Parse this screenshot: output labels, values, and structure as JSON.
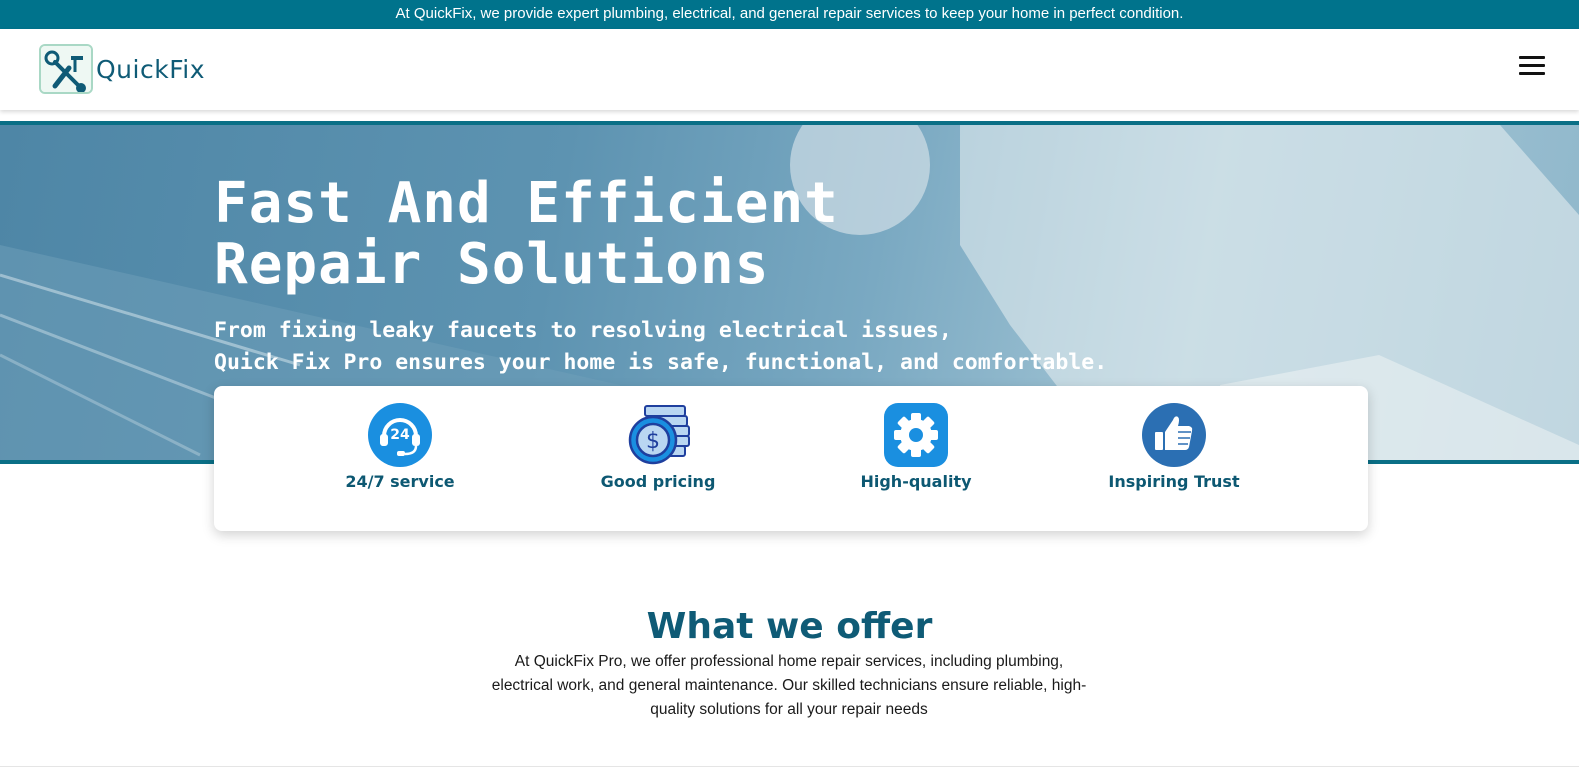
{
  "announcement": "At QuickFix, we provide expert plumbing, electrical, and general repair services to keep your home in perfect condition.",
  "brand": {
    "name": "QuickFix"
  },
  "nav": {
    "menu_icon": "hamburger-menu-icon"
  },
  "hero": {
    "title_line1": "Fast And Efficient",
    "title_line2": "Repair Solutions",
    "subtitle_line1": "From fixing leaky faucets to resolving electrical issues,",
    "subtitle_line2": "Quick Fix Pro ensures your home is safe, functional, and comfortable."
  },
  "features": [
    {
      "label": "24/7 service",
      "icon": "24-hour-support-icon"
    },
    {
      "label": "Good pricing",
      "icon": "dollar-coin-icon"
    },
    {
      "label": "High-quality",
      "icon": "gear-icon"
    },
    {
      "label": "Inspiring Trust",
      "icon": "thumbs-up-icon"
    }
  ],
  "offer": {
    "title": "What we offer",
    "description": "At QuickFix Pro, we offer professional home repair services, including plumbing, electrical work, and general maintenance. Our skilled technicians ensure reliable, high-quality solutions for all your repair needs"
  },
  "colors": {
    "primary": "#00738c",
    "heading": "#0f5b76",
    "feature_blue": "#1a8fe0",
    "white": "#ffffff"
  }
}
